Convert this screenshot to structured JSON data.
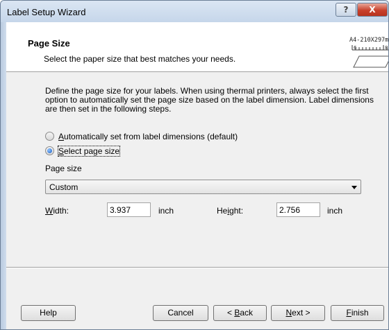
{
  "window": {
    "title": "Label Setup Wizard"
  },
  "titlebar": {
    "help_glyph": "?",
    "close_glyph": "X"
  },
  "header": {
    "title": "Page Size",
    "subtitle": "Select the paper size that best matches your needs.",
    "badge_text": "A4-210X297m",
    "icon": "page-size-ruler-icon"
  },
  "description": "Define the page size for your labels. When using thermal printers, always select the first option to automatically set the page size based on the label dimension. Label dimensions are then set in the following steps.",
  "options": [
    {
      "label_pre": "",
      "label_accel": "A",
      "label_post": "utomatically set from label dimensions (default)",
      "selected": false
    },
    {
      "label_pre": "",
      "label_accel": "S",
      "label_post": "elect page size",
      "selected": true
    }
  ],
  "page_size": {
    "label": "Page size",
    "selected": "Custom"
  },
  "width": {
    "label_accel": "W",
    "label_post": "idth:",
    "value": "3.937",
    "unit": "inch"
  },
  "height": {
    "label_pre": "He",
    "label_accel": "i",
    "label_post": "ght:",
    "value": "2.756",
    "unit": "inch"
  },
  "buttons": {
    "help": "Help",
    "cancel": "Cancel",
    "back_pre": "< ",
    "back_accel": "B",
    "back_post": "ack",
    "next_accel": "N",
    "next_post": "ext >",
    "finish_accel": "F",
    "finish_post": "inish"
  }
}
